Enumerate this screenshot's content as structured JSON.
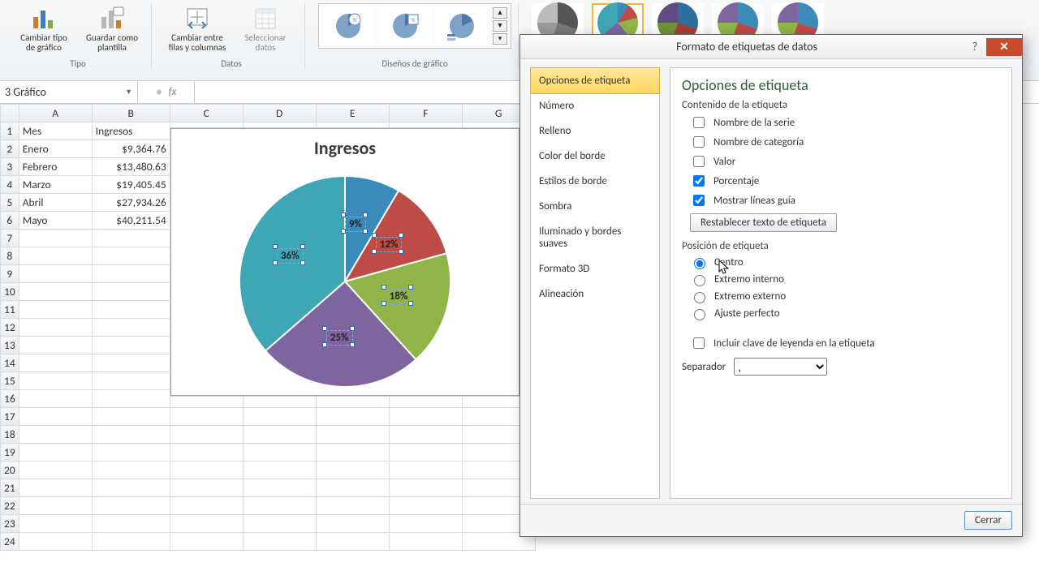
{
  "ribbon": {
    "groups": {
      "tipo": {
        "label": "Tipo",
        "cambiar_tipo": "Cambiar tipo\nde gráfico",
        "guardar_plantilla": "Guardar como\nplantilla"
      },
      "datos": {
        "label": "Datos",
        "cambiar_filas": "Cambiar entre\nfilas y columnas",
        "seleccionar": "Seleccionar\ndatos"
      },
      "disenos": {
        "label": "Diseños de gráfico"
      }
    }
  },
  "formula_bar": {
    "name_box": "3 Gráfico",
    "fx": "fx",
    "value": ""
  },
  "grid": {
    "cols": [
      "A",
      "B",
      "C",
      "D",
      "E",
      "F",
      "G"
    ],
    "header": {
      "A": "Mes",
      "B": "Ingresos"
    },
    "rows": [
      {
        "A": "Enero",
        "B": "$9,364.76"
      },
      {
        "A": "Febrero",
        "B": "$13,480.63"
      },
      {
        "A": "Marzo",
        "B": "$19,405.45"
      },
      {
        "A": "Abril",
        "B": "$27,934.26"
      },
      {
        "A": "Mayo",
        "B": "$40,211.54"
      }
    ]
  },
  "chart_title": "Ingresos",
  "chart_data": {
    "type": "pie",
    "title": "Ingresos",
    "categories": [
      "Enero",
      "Febrero",
      "Marzo",
      "Abril",
      "Mayo"
    ],
    "values": [
      9364.76,
      13480.63,
      19405.45,
      27934.26,
      40211.54
    ],
    "percent_labels": [
      "9%",
      "12%",
      "18%",
      "25%",
      "36%"
    ],
    "colors": [
      "#3b8bba",
      "#bf4b46",
      "#8fb548",
      "#7e659f",
      "#3fa6b5"
    ]
  },
  "dialog": {
    "title": "Formato de etiquetas de datos",
    "nav": [
      "Opciones de etiqueta",
      "Número",
      "Relleno",
      "Color del borde",
      "Estilos de borde",
      "Sombra",
      "Iluminado y bordes suaves",
      "Formato 3D",
      "Alineación"
    ],
    "nav_selected": 0,
    "panel_title": "Opciones de etiqueta",
    "content_heading": "Contenido de la etiqueta",
    "checks": [
      {
        "label": "Nombre de la serie",
        "checked": false
      },
      {
        "label": "Nombre de categoría",
        "checked": false
      },
      {
        "label": "Valor",
        "checked": false
      },
      {
        "label": "Porcentaje",
        "checked": true
      },
      {
        "label": "Mostrar líneas guía",
        "checked": true
      }
    ],
    "reset_btn": "Restablecer texto de etiqueta",
    "pos_heading": "Posición de etiqueta",
    "radios": [
      {
        "label": "Centro",
        "checked": true
      },
      {
        "label": "Extremo interno",
        "checked": false
      },
      {
        "label": "Extremo externo",
        "checked": false
      },
      {
        "label": "Ajuste perfecto",
        "checked": false
      }
    ],
    "legend_key": {
      "label": "Incluir clave de leyenda en la etiqueta",
      "checked": false
    },
    "separator_label": "Separador",
    "separator_value": ",",
    "close": "Cerrar"
  }
}
